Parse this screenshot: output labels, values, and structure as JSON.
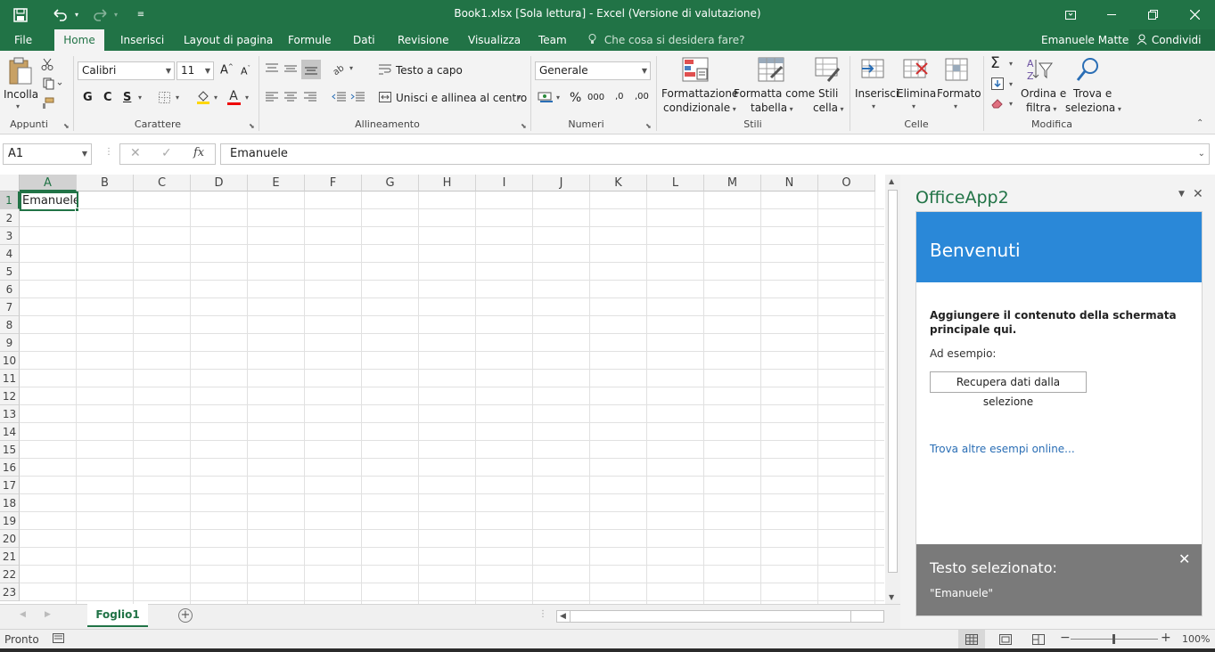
{
  "titlebar": {
    "title": "Book1.xlsx  [Sola lettura] - Excel (Versione di valutazione)",
    "save_icon": "save-icon",
    "undo_icon": "undo-icon",
    "redo_icon": "redo-icon"
  },
  "tabs": {
    "file": "File",
    "items": [
      "Home",
      "Inserisci",
      "Layout di pagina",
      "Formule",
      "Dati",
      "Revisione",
      "Visualizza",
      "Team"
    ],
    "active": "Home",
    "tell_me": "Che cosa si desidera fare?",
    "user": "Emanuele Mattei",
    "share": "Condividi"
  },
  "ribbon": {
    "clipboard": {
      "paste": "Incolla",
      "label": "Appunti"
    },
    "font": {
      "name": "Calibri",
      "size": "11",
      "bold": "G",
      "italic": "C",
      "underline": "S",
      "label": "Carattere",
      "grow": "A",
      "shrink": "A",
      "font_color": "A"
    },
    "alignment": {
      "wrap": "Testo a capo",
      "merge": "Unisci e allinea al centro",
      "label": "Allineamento"
    },
    "number": {
      "format": "Generale",
      "percent": "%",
      "thousands": "000",
      "inc_dec": ",0",
      "dec_dec": ",00",
      "label": "Numeri"
    },
    "styles": {
      "conditional_1": "Formattazione",
      "conditional_2": "condizionale",
      "table_1": "Formatta come",
      "table_2": "tabella",
      "cell_1": "Stili",
      "cell_2": "cella",
      "label": "Stili"
    },
    "cells": {
      "insert": "Inserisci",
      "delete": "Elimina",
      "format": "Formato",
      "label": "Celle"
    },
    "editing": {
      "sort_1": "Ordina e",
      "sort_2": "filtra",
      "find_1": "Trova e",
      "find_2": "seleziona",
      "label": "Modifica"
    }
  },
  "formula_bar": {
    "name_box": "A1",
    "fx": "fx",
    "value": "Emanuele"
  },
  "grid": {
    "columns": [
      "A",
      "B",
      "C",
      "D",
      "E",
      "F",
      "G",
      "H",
      "I",
      "J",
      "K",
      "L",
      "M",
      "N",
      "O"
    ],
    "rows": [
      "1",
      "2",
      "3",
      "4",
      "5",
      "6",
      "7",
      "8",
      "9",
      "10",
      "11",
      "12",
      "13",
      "14",
      "15",
      "16",
      "17",
      "18",
      "19",
      "20",
      "21",
      "22",
      "23"
    ],
    "cell_a1": "Emanuele"
  },
  "sheets": {
    "tabs": [
      "Foglio1"
    ],
    "add": "+"
  },
  "taskpane": {
    "title": "OfficeApp2",
    "banner": "Benvenuti",
    "heading": "Aggiungere il contenuto della schermata principale qui.",
    "example_label": "Ad esempio:",
    "button": "Recupera dati dalla selezione",
    "link": "Trova altre esempi online...",
    "footer_title": "Testo selezionato:",
    "footer_text": "\"Emanuele\""
  },
  "statusbar": {
    "status": "Pronto",
    "zoom": "100%"
  },
  "colors": {
    "accent": "#217346",
    "banner": "#2a88d8",
    "footer": "#7a7a7a"
  }
}
